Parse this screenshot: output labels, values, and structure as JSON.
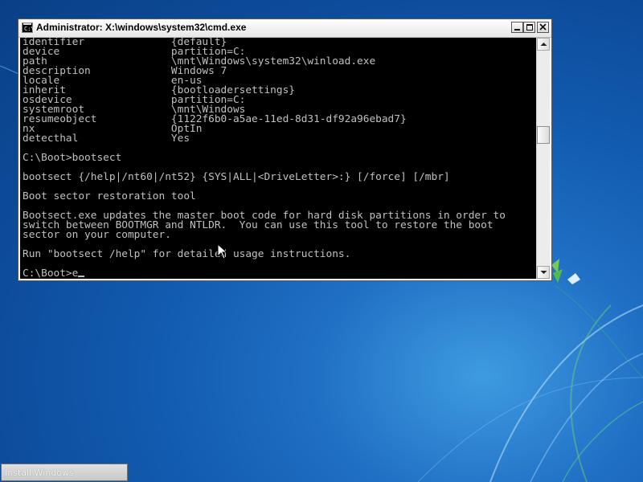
{
  "window": {
    "title": "Administrator: X:\\windows\\system32\\cmd.exe",
    "icon": "console-icon",
    "icon_glyph": "C:\\"
  },
  "console": {
    "lines": [
      "identifier              {default}",
      "device                  partition=C:",
      "path                    \\mnt\\Windows\\system32\\winload.exe",
      "description             Windows 7",
      "locale                  en-us",
      "inherit                 {bootloadersettings}",
      "osdevice                partition=C:",
      "systemroot              \\mnt\\Windows",
      "resumeobject            {1122f6b0-a5ae-11ed-8d31-df92a96ebad7}",
      "nx                      OptIn",
      "detecthal               Yes",
      "",
      "C:\\Boot>bootsect",
      "",
      "bootsect {/help|/nt60|/nt52} {SYS|ALL|<DriveLetter>:} [/force] [/mbr]",
      "",
      "Boot sector restoration tool",
      "",
      "Bootsect.exe updates the master boot code for hard disk partitions in order to",
      "switch between BOOTMGR and NTLDR.  You can use this tool to restore the boot",
      "sector on your computer.",
      "",
      "Run \"bootsect /help\" for detailed usage instructions.",
      "",
      "C:\\Boot>e"
    ],
    "text_color": "#c0c0c0",
    "background_color": "#000000"
  },
  "taskbar": {
    "install_label": "Install Windows"
  },
  "colors": {
    "desktop_blue": "#125bb0",
    "accent_glow": "#58c455"
  }
}
